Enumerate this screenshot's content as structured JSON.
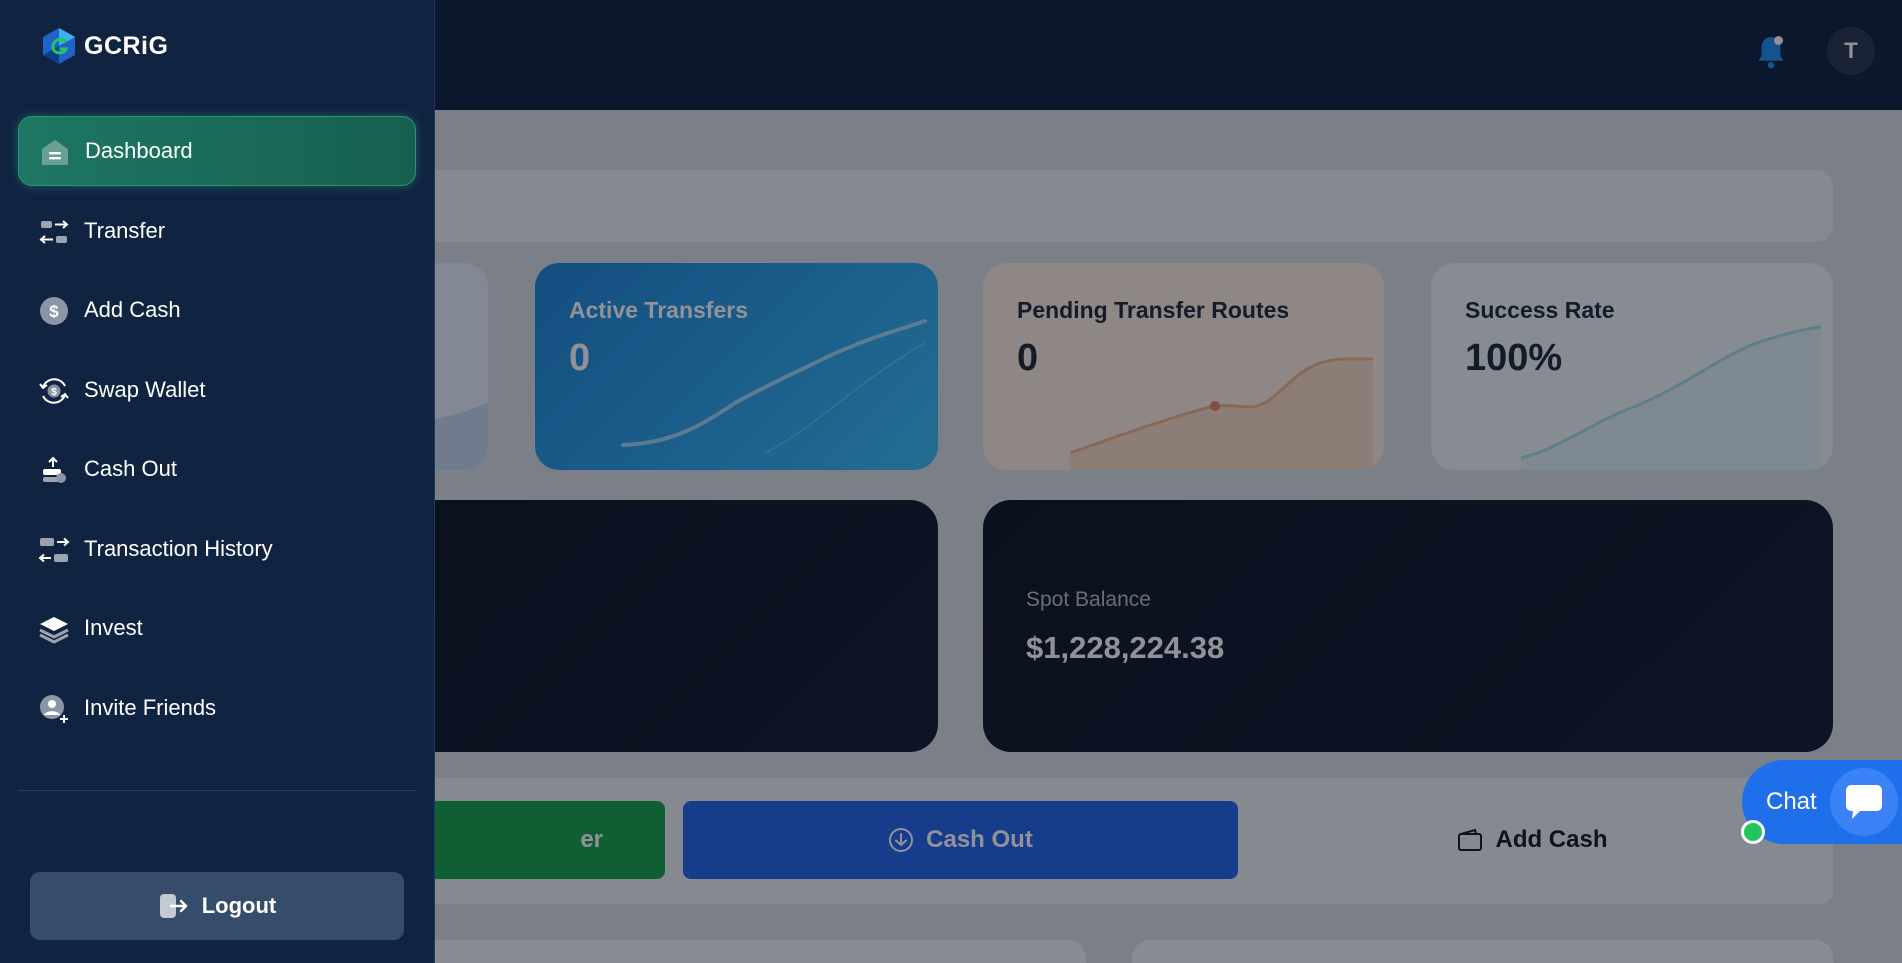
{
  "app": {
    "brand": "GCRiG"
  },
  "header": {
    "avatar_initial": "T"
  },
  "sidebar": {
    "items": [
      {
        "label": "Dashboard",
        "icon": "home-icon",
        "active": true
      },
      {
        "label": "Transfer",
        "icon": "transfer-icon"
      },
      {
        "label": "Add Cash",
        "icon": "dollar-icon"
      },
      {
        "label": "Swap Wallet",
        "icon": "swap-icon"
      },
      {
        "label": "Cash Out",
        "icon": "cash-out-icon"
      },
      {
        "label": "Transaction History",
        "icon": "history-icon"
      },
      {
        "label": "Invest",
        "icon": "layers-icon"
      },
      {
        "label": "Invite Friends",
        "icon": "user-add-icon"
      }
    ],
    "logout_label": "Logout"
  },
  "stats": [
    {
      "label": "Active Transfers",
      "value": "0"
    },
    {
      "label": "Pending Transfer Routes",
      "value": "0"
    },
    {
      "label": "Success Rate",
      "value": "100%"
    }
  ],
  "balance": {
    "label": "Spot Balance",
    "value": "$1,228,224.38"
  },
  "actions": {
    "transfer_partial": "er",
    "cash_out": "Cash Out",
    "add_cash": "Add Cash"
  },
  "chat": {
    "label": "Chat"
  },
  "colors": {
    "sidebar_bg": "#102341",
    "active_green": "#1d7763",
    "primary_blue": "#2563eb",
    "success_green": "#16a34a"
  }
}
